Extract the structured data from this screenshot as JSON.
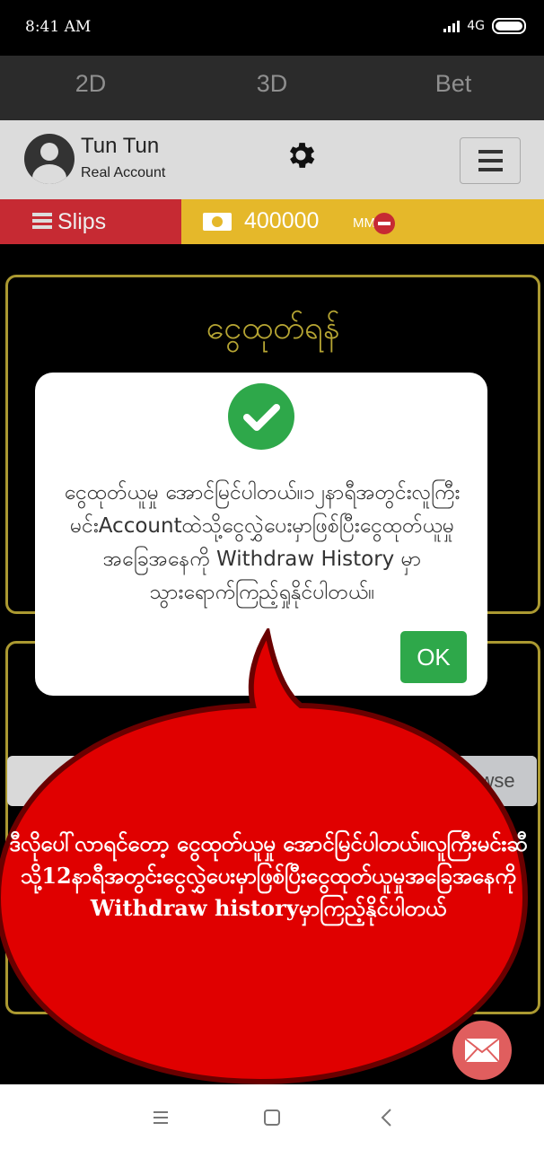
{
  "status_bar": {
    "time": "8:41 AM",
    "network": "4G"
  },
  "top_nav": {
    "tabs": [
      "2D",
      "3D",
      "Bet"
    ]
  },
  "user": {
    "name": "Tun Tun",
    "account_type": "Real Account"
  },
  "icons": {
    "settings": "gear-icon",
    "menu": "hamburger-menu-icon",
    "slips": "list-icon",
    "balance": "cash-icon",
    "withdraw": "minus-circle-icon",
    "success": "check-circle-icon",
    "mail": "envelope-icon"
  },
  "slips": {
    "label": "Slips"
  },
  "balance": {
    "amount": "400000",
    "currency": "MMK"
  },
  "withdraw_panel": {
    "title": "ငွေထုတ်ရန်"
  },
  "upload": {
    "browse_label": "owse"
  },
  "dialog": {
    "message": "ငွေထုတ်ယူမှု အောင်မြင်ပါတယ်။၁၂နာရီအတွင်းလူကြီးမင်းAccountထဲသို့ငွေလွှဲပေးမှာဖြစ်ပြီးငွေထုတ်ယူမှုအခြေအနေကို Withdraw History မှာ သွားရောက်ကြည့်ရှုနိုင်ပါတယ်။",
    "ok_label": "OK"
  },
  "callout": {
    "text": "ဒီလိုပေါ်လာရင်တော့ ငွေထုတ်ယူမှု အောင်မြင်ပါတယ်။လူကြီးမင်းဆီသို့12နာရီအတွင်းငွေလွှဲပေးမှာဖြစ်ပြီးငွေထုတ်ယူမှုအခြေအနေကို Withdraw historyမှာကြည့်နိုင်ပါတယ်"
  },
  "colors": {
    "nav_bg": "#2b2b2b",
    "slips_red": "#c62a33",
    "balance_gold": "#e5b82a",
    "panel_border": "#c9b43a",
    "success_green": "#2ea84a",
    "callout_red": "#e00000"
  }
}
